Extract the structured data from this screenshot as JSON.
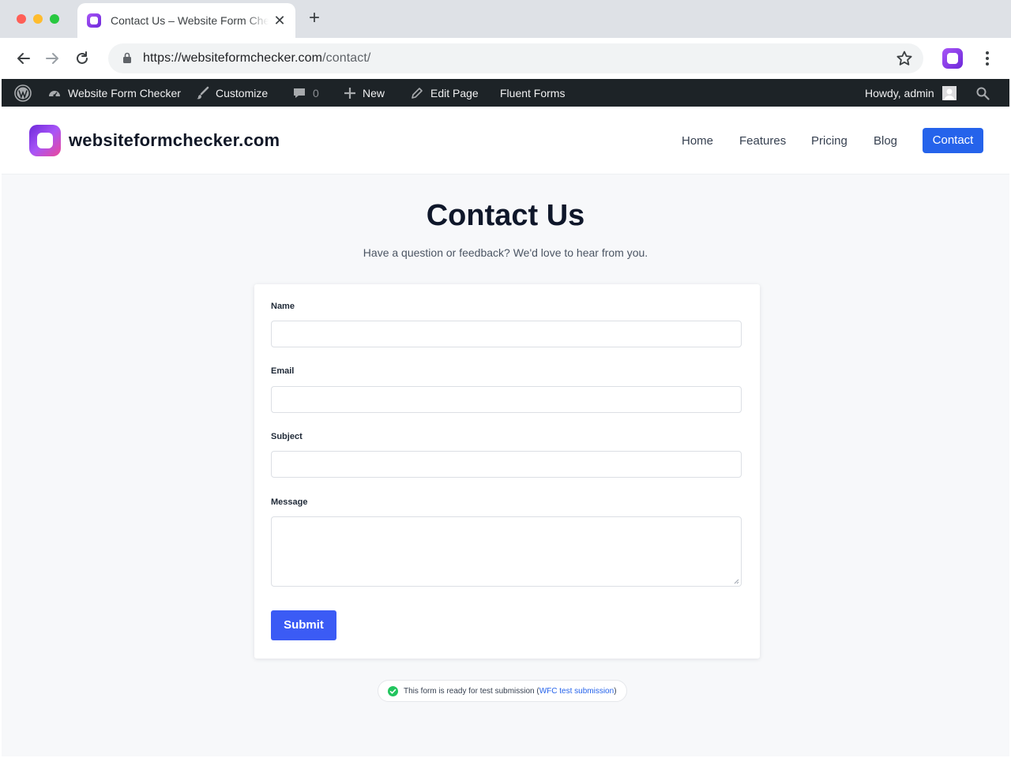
{
  "browser": {
    "tab_title": "Contact Us – Website Form Checker",
    "tab_close": "✕",
    "new_tab": "+",
    "url_host": "https://websiteformchecker.com",
    "url_path": "/contact/",
    "icons": [
      "back-arrow-icon",
      "forward-arrow-icon",
      "reload-icon",
      "lock-icon",
      "star-icon",
      "extension-icon",
      "menu-dots-icon"
    ]
  },
  "admin_bar": {
    "site_name": "Website Form Checker",
    "customize": "Customize",
    "comments_count": "0",
    "new": "New",
    "edit_page": "Edit Page",
    "fluent_forms": "Fluent Forms",
    "howdy": "Howdy, admin",
    "bg_color": "#1d2327"
  },
  "site": {
    "brand": "websiteformchecker.com",
    "nav": {
      "home": "Home",
      "features": "Features",
      "pricing": "Pricing",
      "blog": "Blog",
      "contact": "Contact"
    },
    "accent_color": "#2563eb"
  },
  "main": {
    "title": "Contact Us",
    "subtitle": "Have a question or feedback? We'd love to hear from you.",
    "form": {
      "name_label": "Name",
      "name_value": "",
      "email_label": "Email",
      "email_value": "",
      "subject_label": "Subject",
      "subject_value": "",
      "message_label": "Message",
      "message_value": "",
      "submit_label": "Submit"
    },
    "status": {
      "text": "This form is ready for test submission (",
      "link": "WFC test submission",
      "suffix": ")",
      "color": "#22c55e"
    }
  }
}
